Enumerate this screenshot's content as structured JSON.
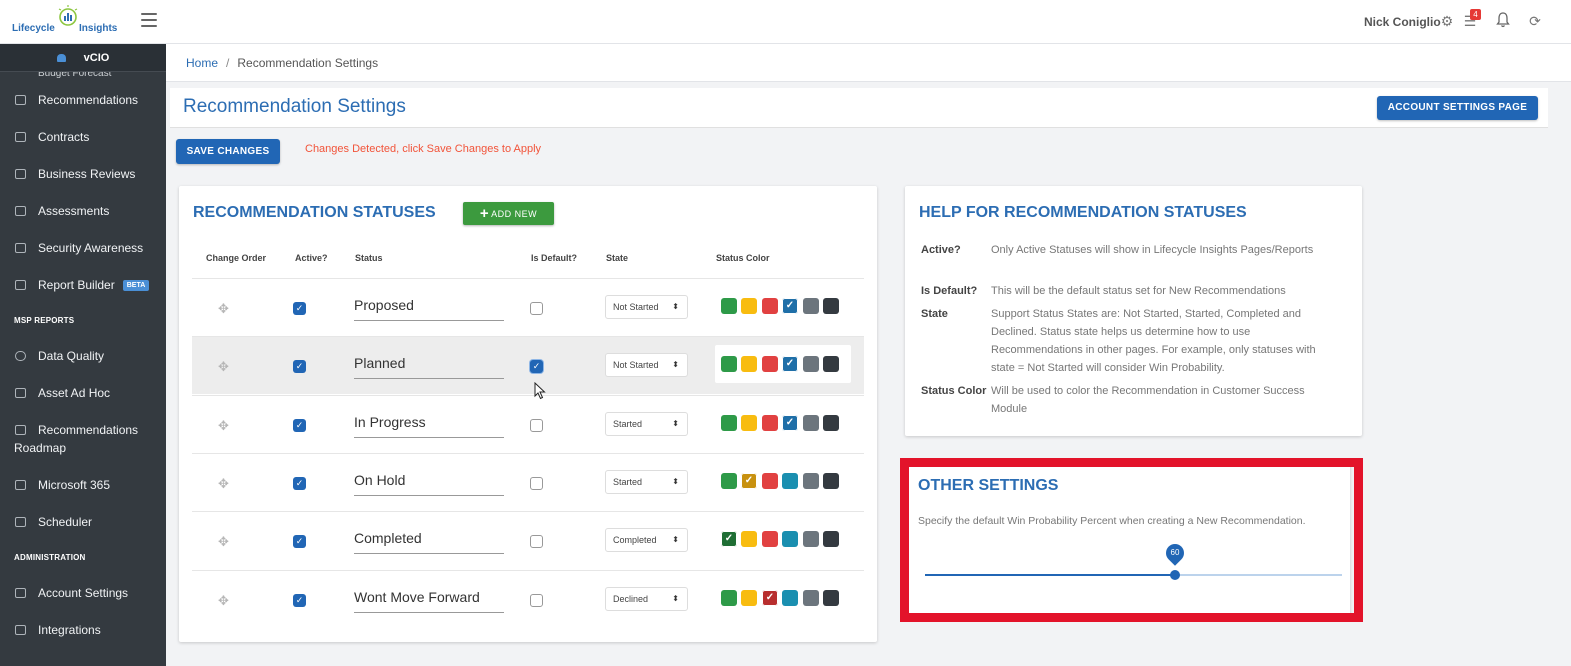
{
  "app": {
    "logo_word1": "Lifecycle",
    "logo_word2": "Insights",
    "user_name": "Nick Coniglio",
    "notification_count": "4"
  },
  "sidebar": {
    "header": "vCIO",
    "cut_item": "Budget Forecast",
    "items_top": [
      {
        "label": "Recommendations",
        "icon": "list-icon"
      },
      {
        "label": "Contracts",
        "icon": "contract-icon"
      },
      {
        "label": "Business Reviews",
        "icon": "copy-icon"
      },
      {
        "label": "Assessments",
        "icon": "edit-icon"
      },
      {
        "label": "Security Awareness",
        "icon": "key-icon"
      },
      {
        "label": "Report Builder",
        "icon": "report-icon",
        "badge": "BETA"
      }
    ],
    "section_msp": "MSP REPORTS",
    "items_msp": [
      {
        "label": "Data Quality",
        "icon": "gauge-icon"
      },
      {
        "label": "Asset Ad Hoc",
        "icon": "file-icon"
      },
      {
        "label": "Recommendations",
        "label2": "Roadmap",
        "icon": "list-icon"
      },
      {
        "label": "Microsoft 365",
        "icon": "windows-icon"
      },
      {
        "label": "Scheduler",
        "icon": "calendar-icon"
      }
    ],
    "section_admin": "ADMINISTRATION",
    "items_admin": [
      {
        "label": "Account Settings",
        "icon": "wrench-icon"
      },
      {
        "label": "Integrations",
        "icon": "integrations-icon"
      }
    ]
  },
  "breadcrumb": {
    "home": "Home",
    "separator": "/",
    "current": "Recommendation Settings"
  },
  "page": {
    "title": "Recommendation Settings",
    "account_settings_button": "ACCOUNT SETTINGS PAGE",
    "save_button": "SAVE CHANGES",
    "change_message": "Changes Detected, click Save Changes to Apply"
  },
  "statuses": {
    "title": "RECOMMENDATION STATUSES",
    "add_button": "ADD NEW",
    "columns": [
      "Change Order",
      "Active?",
      "Status",
      "Is Default?",
      "State",
      "Status Color"
    ],
    "palette": [
      "#2e9a48",
      "#f8bc10",
      "#e14141",
      "#1a8fb0",
      "#6c757d",
      "#343a40"
    ],
    "rows": [
      {
        "status": "Proposed",
        "active": true,
        "is_default": false,
        "state": "Not Started",
        "selected_color": 3,
        "selected_palette_override": "#1f6fa8"
      },
      {
        "status": "Planned",
        "active": true,
        "is_default": true,
        "state": "Not Started",
        "selected_color": 3,
        "selected_palette_override": "#1f6fa8"
      },
      {
        "status": "In Progress",
        "active": true,
        "is_default": false,
        "state": "Started",
        "selected_color": 3,
        "selected_palette_override": "#1f6fa8"
      },
      {
        "status": "On Hold",
        "active": true,
        "is_default": false,
        "state": "Started",
        "selected_color": 1,
        "selected_palette_override": "#c8910f"
      },
      {
        "status": "Completed",
        "active": true,
        "is_default": false,
        "state": "Completed",
        "selected_color": 0,
        "selected_palette_override": "#1f6e34"
      },
      {
        "status": "Wont Move Forward",
        "active": true,
        "is_default": false,
        "state": "Declined",
        "selected_color": 2,
        "selected_palette_override": "#b82e2e"
      }
    ]
  },
  "help": {
    "title": "HELP FOR RECOMMENDATION STATUSES",
    "items": [
      {
        "term": "Active?",
        "definition": "Only Active Statuses will show in Lifecycle Insights Pages/Reports"
      },
      {
        "term": "Is Default?",
        "definition": "This will be the default status set for New Recommendations"
      },
      {
        "term": "State",
        "definition": "Support Status States are: Not Started, Started, Completed and Declined. Status state helps us determine how to use Recommendations in other pages. For example, only statuses with state = Not Started will consider Win Probability."
      },
      {
        "term": "Status Color",
        "definition": "Will be used to color the Recommendation in Customer Success Module"
      }
    ]
  },
  "other_settings": {
    "title": "OTHER SETTINGS",
    "description": "Specify the default Win Probability Percent when creating a New Recommendation.",
    "win_probability": 60,
    "min": 0,
    "max": 100
  }
}
